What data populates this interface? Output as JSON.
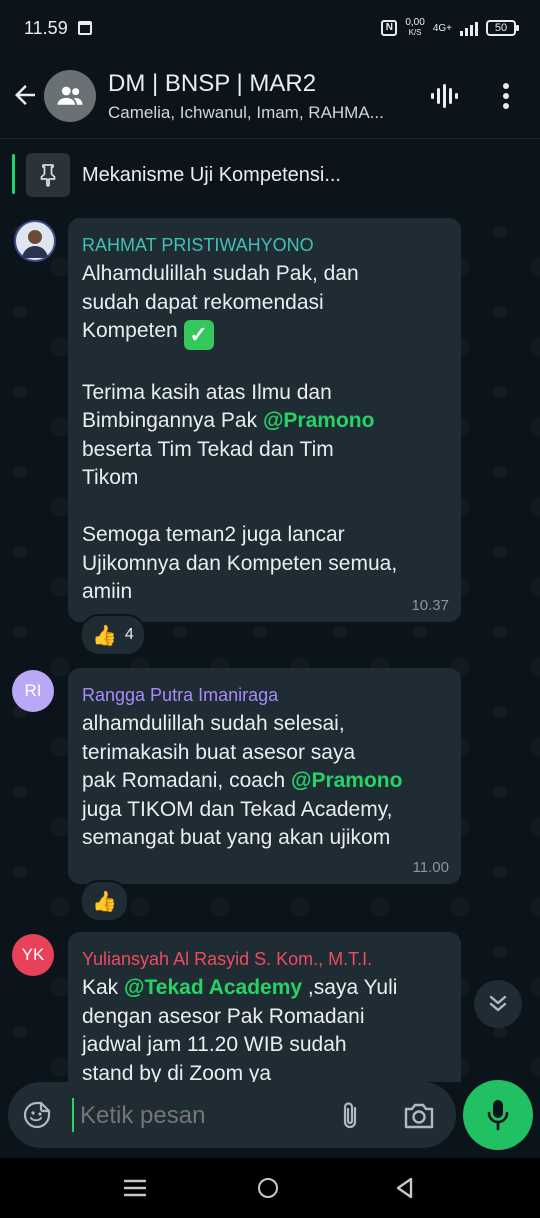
{
  "status_bar": {
    "time": "11.59",
    "speed_value": "0,00",
    "speed_unit": "K/S",
    "network": "4G+",
    "battery": "50"
  },
  "header": {
    "title": "DM | BNSP | MAR2",
    "members": "Camelia, Ichwanul, Imam, RAHMA..."
  },
  "pinned": {
    "text": "Mekanisme Uji Kompetensi..."
  },
  "messages": [
    {
      "sender": "RAHMAT PRISTIWAHYONO",
      "sender_color": "#3dc1b8",
      "line1": "Alhamdulillah sudah Pak, dan\nsudah dapat rekomendasi\nKompeten ",
      "line2": "\n\nTerima kasih atas Ilmu dan\nBimbingannya Pak ",
      "mention": "@Pramono",
      "line3": "\nbeserta Tim Tekad dan Tim\nTikom\n\nSemoga teman2 juga lancar\nUjikomnya dan Kompeten semua,\namiin",
      "time": "10.37",
      "reaction_count": "4"
    },
    {
      "sender": "Rangga Putra Imaniraga",
      "sender_color": "#a78bfa",
      "avatar_initials": "RI",
      "avatar_color": "#b9a8f5",
      "line1": "alhamdulillah sudah selesai,\nterimakasih buat asesor saya\npak Romadani, coach ",
      "mention": "@Pramono",
      "line2": "\njuga TIKOM dan Tekad Academy,\nsemangat buat yang akan ujikom",
      "time": "11.00"
    },
    {
      "sender": "Yuliansyah Al Rasyid S. Kom., M.T.I.",
      "sender_color": "#ef4a5f",
      "avatar_initials": "YK",
      "avatar_color": "#e8425a",
      "line1": "Kak ",
      "mention": "@Tekad Academy",
      "line2": " ,saya Yuli\ndengan asesor Pak Romadani\njadwal jam 11.20 WIB sudah\nstand by di Zoom ya"
    }
  ],
  "composer": {
    "placeholder": "Ketik pesan"
  },
  "icons": {
    "back": "arrow-left",
    "group_avatar": "group",
    "voice": "voice-chat",
    "menu": "more-vertical",
    "pin": "pin",
    "emoji": "sticker",
    "attach": "paperclip",
    "camera": "camera",
    "mic": "microphone",
    "scroll": "double-chevron-down",
    "reaction": "thumbs-up"
  },
  "colors": {
    "background": "#0b141a",
    "bubble": "#202c33",
    "accent": "#21c063",
    "mention": "#25d366"
  }
}
